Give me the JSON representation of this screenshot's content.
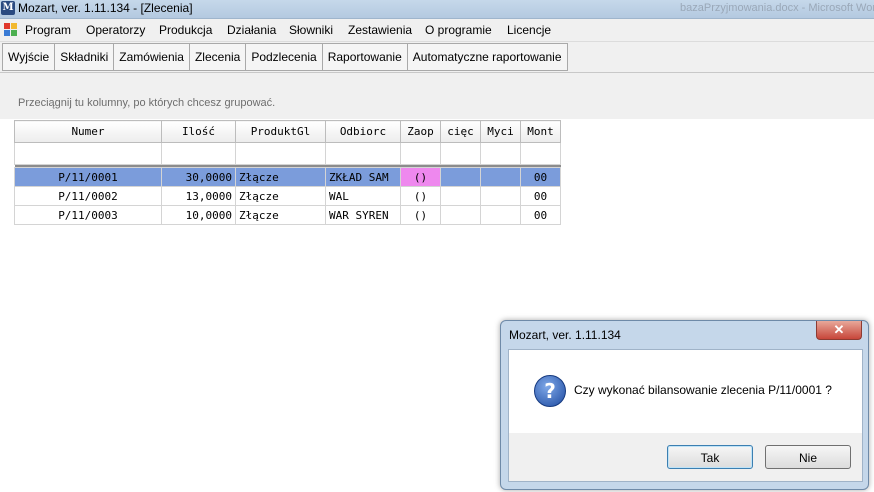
{
  "window": {
    "title": "Mozart, ver. 1.11.134 - [Zlecenia]",
    "app_icon_letter": "M",
    "background_title": "bazaPrzyjmowania.docx - Microsoft Word"
  },
  "menu": [
    {
      "label": "Program"
    },
    {
      "label": "Operatorzy"
    },
    {
      "label": "Produkcja"
    },
    {
      "label": "Działania"
    },
    {
      "label": "Słowniki"
    },
    {
      "label": "Zestawienia"
    },
    {
      "label": "O programie"
    },
    {
      "label": "Licencje"
    }
  ],
  "toolbar": [
    {
      "label": "Wyjście"
    },
    {
      "label": "Składniki"
    },
    {
      "label": "Zamówienia"
    },
    {
      "label": "Zlecenia"
    },
    {
      "label": "Podzlecenia"
    },
    {
      "label": "Raportowanie"
    },
    {
      "label": "Automatyczne raportowanie"
    }
  ],
  "group_hint": "Przeciągnij tu kolumny, po których chcesz grupować.",
  "grid": {
    "columns": [
      "Numer",
      "Ilość",
      "ProduktGl",
      "Odbiorc",
      "Zaop",
      "cięc",
      "Myci",
      "Mont"
    ],
    "rows": [
      {
        "numer": "P/11/0001",
        "ilosc": "30,0000",
        "produkt": "Złącze",
        "odbiorca": "ZKŁAD SAM",
        "zaop": "()",
        "ciec": "",
        "myci": "",
        "mont": "00",
        "selected": true
      },
      {
        "numer": "P/11/0002",
        "ilosc": "13,0000",
        "produkt": "Złącze",
        "odbiorca": "WAL",
        "zaop": "()",
        "ciec": "",
        "myci": "",
        "mont": "00",
        "selected": false
      },
      {
        "numer": "P/11/0003",
        "ilosc": "10,0000",
        "produkt": "Złącze",
        "odbiorca": "WAR SYREN",
        "zaop": "()",
        "ciec": "",
        "myci": "",
        "mont": "00",
        "selected": false
      }
    ]
  },
  "dialog": {
    "title": "Mozart, ver. 1.11.134",
    "message": "Czy wykonać bilansowanie zlecenia P/11/0001 ?",
    "icon": "question-icon",
    "close_glyph": "✕",
    "yes_label": "Tak",
    "no_label": "Nie"
  },
  "colors": {
    "selection": "#7b9cdb",
    "highlight_cell": "#ee88ee",
    "dialog_frame": "#c5d7ea"
  }
}
